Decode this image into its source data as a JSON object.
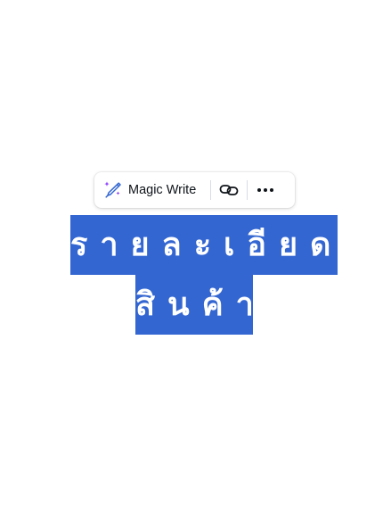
{
  "toolbar": {
    "magic_write_label": "Magic Write",
    "icons": [
      "magic-pen-icon",
      "link-icon",
      "more-icon"
    ]
  },
  "text_box": {
    "line1": "รายละเอียด",
    "line2": "สินค้า",
    "highlight_color": "#3366d1",
    "text_color": "#ffffff"
  }
}
